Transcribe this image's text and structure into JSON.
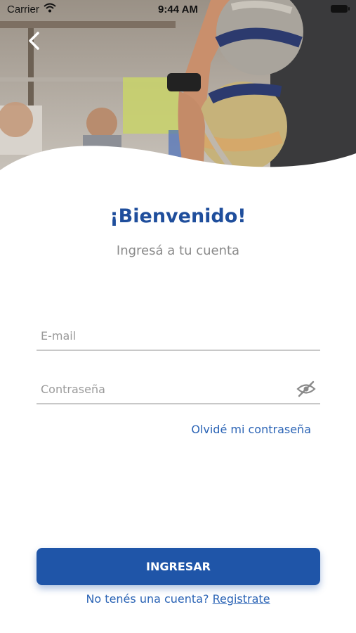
{
  "status_bar": {
    "carrier": "Carrier",
    "time": "9:44 AM"
  },
  "header": {
    "back_icon": "chevron-left-icon"
  },
  "welcome": {
    "title": "¡Bienvenido!",
    "subtitle": "Ingresá a tu cuenta"
  },
  "form": {
    "email_placeholder": "E-mail",
    "password_placeholder": "Contraseña",
    "password_toggle_icon": "eye-slash-icon",
    "forgot_password": "Olvidé mi contraseña"
  },
  "login_button": "INGRESAR",
  "register": {
    "prompt": "No tenés una cuenta?",
    "link": "Registrate"
  },
  "colors": {
    "brand_blue": "#1f55a8",
    "title_blue": "#1f4e9c",
    "link_blue": "#2a63b5"
  }
}
